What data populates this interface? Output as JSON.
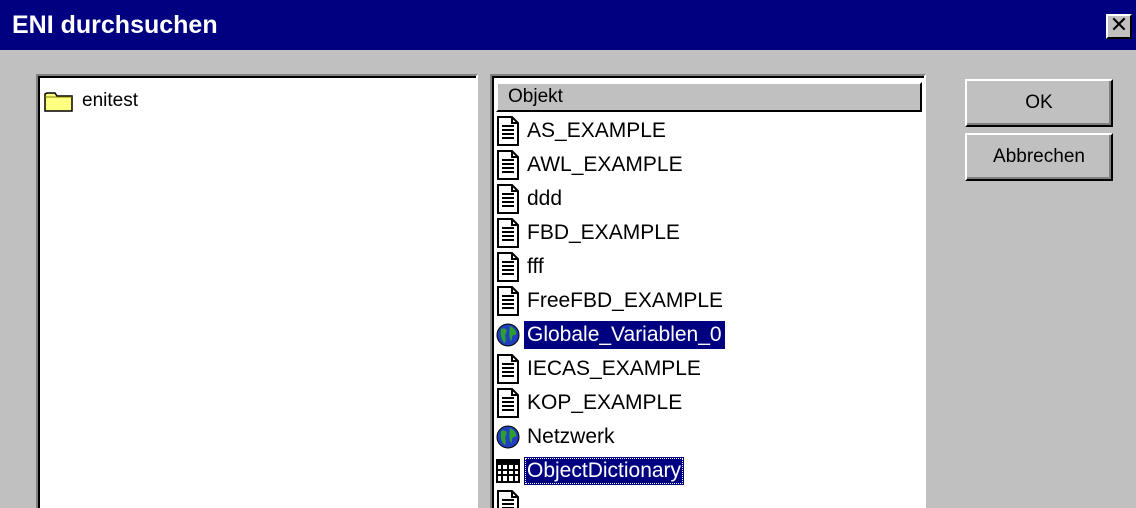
{
  "window": {
    "title": "ENI durchsuchen",
    "close_glyph": "✕"
  },
  "tree": {
    "items": [
      {
        "label": "enitest",
        "icon": "folder-icon"
      }
    ]
  },
  "list": {
    "column_header": "Objekt",
    "rows": [
      {
        "label": "AS_EXAMPLE",
        "icon": "document-icon",
        "selected": false
      },
      {
        "label": "AWL_EXAMPLE",
        "icon": "document-icon",
        "selected": false
      },
      {
        "label": "ddd",
        "icon": "document-icon",
        "selected": false
      },
      {
        "label": "FBD_EXAMPLE",
        "icon": "document-icon",
        "selected": false
      },
      {
        "label": "fff",
        "icon": "document-icon",
        "selected": false
      },
      {
        "label": "FreeFBD_EXAMPLE",
        "icon": "document-icon",
        "selected": false
      },
      {
        "label": "Globale_Variablen_0",
        "icon": "globe-icon",
        "selected": true
      },
      {
        "label": "IECAS_EXAMPLE",
        "icon": "document-icon",
        "selected": false
      },
      {
        "label": "KOP_EXAMPLE",
        "icon": "document-icon",
        "selected": false
      },
      {
        "label": "Netzwerk",
        "icon": "globe-icon",
        "selected": false
      },
      {
        "label": "ObjectDictionary",
        "icon": "grid-icon",
        "selected": true,
        "focused": true
      },
      {
        "label": "",
        "icon": "document-icon",
        "selected": false
      }
    ]
  },
  "buttons": {
    "ok_label": "OK",
    "cancel_label": "Abbrechen"
  },
  "colors": {
    "titlebar": "#000080",
    "face": "#c0c0c0",
    "selection": "#000080"
  }
}
